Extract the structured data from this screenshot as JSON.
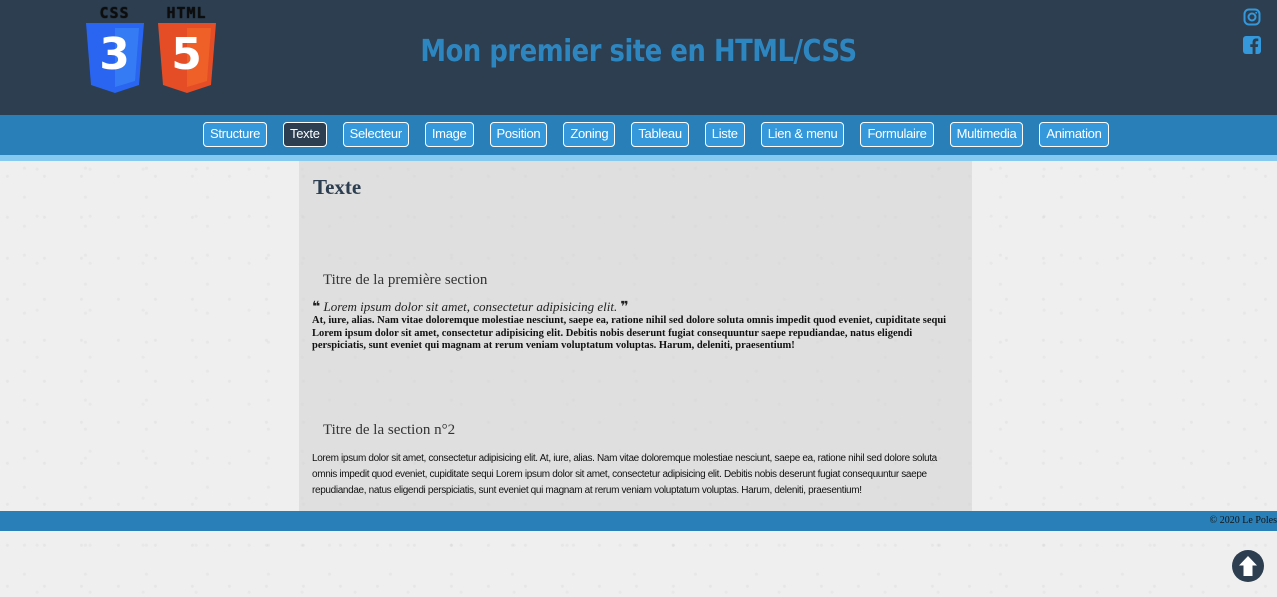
{
  "header": {
    "title": "Mon premier site en HTML/CSS",
    "logos": [
      {
        "label": "CSS",
        "number": "3",
        "color": "#2965f1",
        "icon": "css3-logo-icon"
      },
      {
        "label": "HTML",
        "number": "5",
        "color": "#e44d26",
        "icon": "html5-logo-icon"
      }
    ],
    "social": [
      "instagram-icon",
      "facebook-icon"
    ]
  },
  "nav": {
    "items": [
      "Structure",
      "Texte",
      "Selecteur",
      "Image",
      "Position",
      "Zoning",
      "Tableau",
      "Liste",
      "Lien & menu",
      "Formulaire",
      "Multimedia",
      "Animation"
    ],
    "active": "Texte"
  },
  "main": {
    "title": "Texte",
    "section1": {
      "title": "Titre de la première section",
      "quote_open": "❝",
      "quote": "Lorem ipsum dolor sit amet, consectetur adipisicing elit.",
      "quote_close": "❞",
      "paragraph": "At, iure, alias. Nam vitae doloremque molestiae nesciunt, saepe ea, ratione nihil sed dolore soluta omnis impedit quod eveniet, cupiditate sequi Lorem ipsum dolor sit amet, consectetur adipisicing elit. Debitis nobis deserunt fugiat consequuntur saepe repudiandae, natus eligendi perspiciatis, sunt eveniet qui magnam at rerum veniam voluptatum voluptas. Harum, deleniti, praesentium!"
    },
    "section2": {
      "title": "Titre de la section n°2",
      "paragraph": "Lorem ipsum dolor sit amet, consectetur adipisicing elit. At, iure, alias. Nam vitae doloremque molestiae nesciunt, saepe ea, ratione nihil sed dolore soluta omnis impedit quod eveniet, cupiditate sequi Lorem ipsum dolor sit amet, consectetur adipisicing elit. Debitis nobis deserunt fugiat consequuntur saepe repudiandae, natus eligendi perspiciatis, sunt eveniet qui magnam at rerum veniam voluptatum voluptas. Harum, deleniti, praesentium!"
    }
  },
  "footer": {
    "copyright": "© 2020 Le Poles"
  },
  "colors": {
    "header_bg": "#2c3e50",
    "nav_bg": "#2980b9",
    "accent": "#2e86c1"
  },
  "back_to_top_icon": "arrow-circle-up-icon"
}
